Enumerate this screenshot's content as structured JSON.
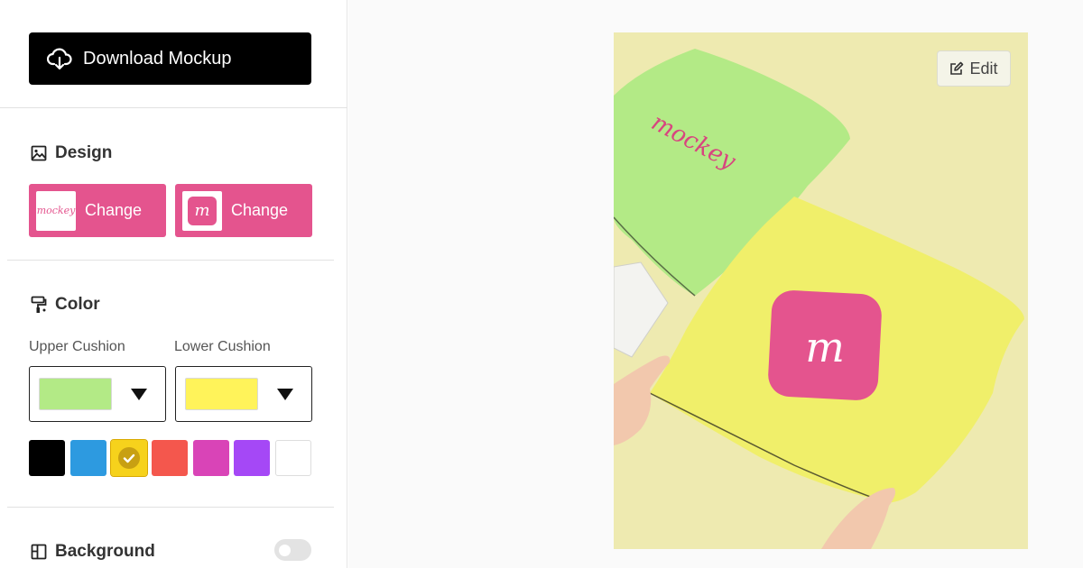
{
  "toolbar": {
    "download_label": "Download Mockup"
  },
  "design": {
    "title": "Design",
    "buttons": [
      {
        "label": "Change",
        "thumb_text": "mockey"
      },
      {
        "label": "Change",
        "thumb_text": "m"
      }
    ]
  },
  "color": {
    "title": "Color",
    "upper": {
      "label": "Upper Cushion",
      "value": "#b3ea86"
    },
    "lower": {
      "label": "Lower Cushion",
      "value": "#fff35a"
    },
    "palette": [
      "#000000",
      "#2d9ae0",
      "#f6d21c",
      "#f4574d",
      "#d944b7",
      "#a548f6",
      "#ffffff"
    ],
    "selected_index": 2
  },
  "background": {
    "title": "Background",
    "enabled": false
  },
  "preview": {
    "edit_label": "Edit",
    "logo_text": "mockey",
    "bg_color": "#eeeab0",
    "upper_color": "#b3ea86",
    "lower_color": "#f0ef6a",
    "badge_color": "#e4548e"
  }
}
